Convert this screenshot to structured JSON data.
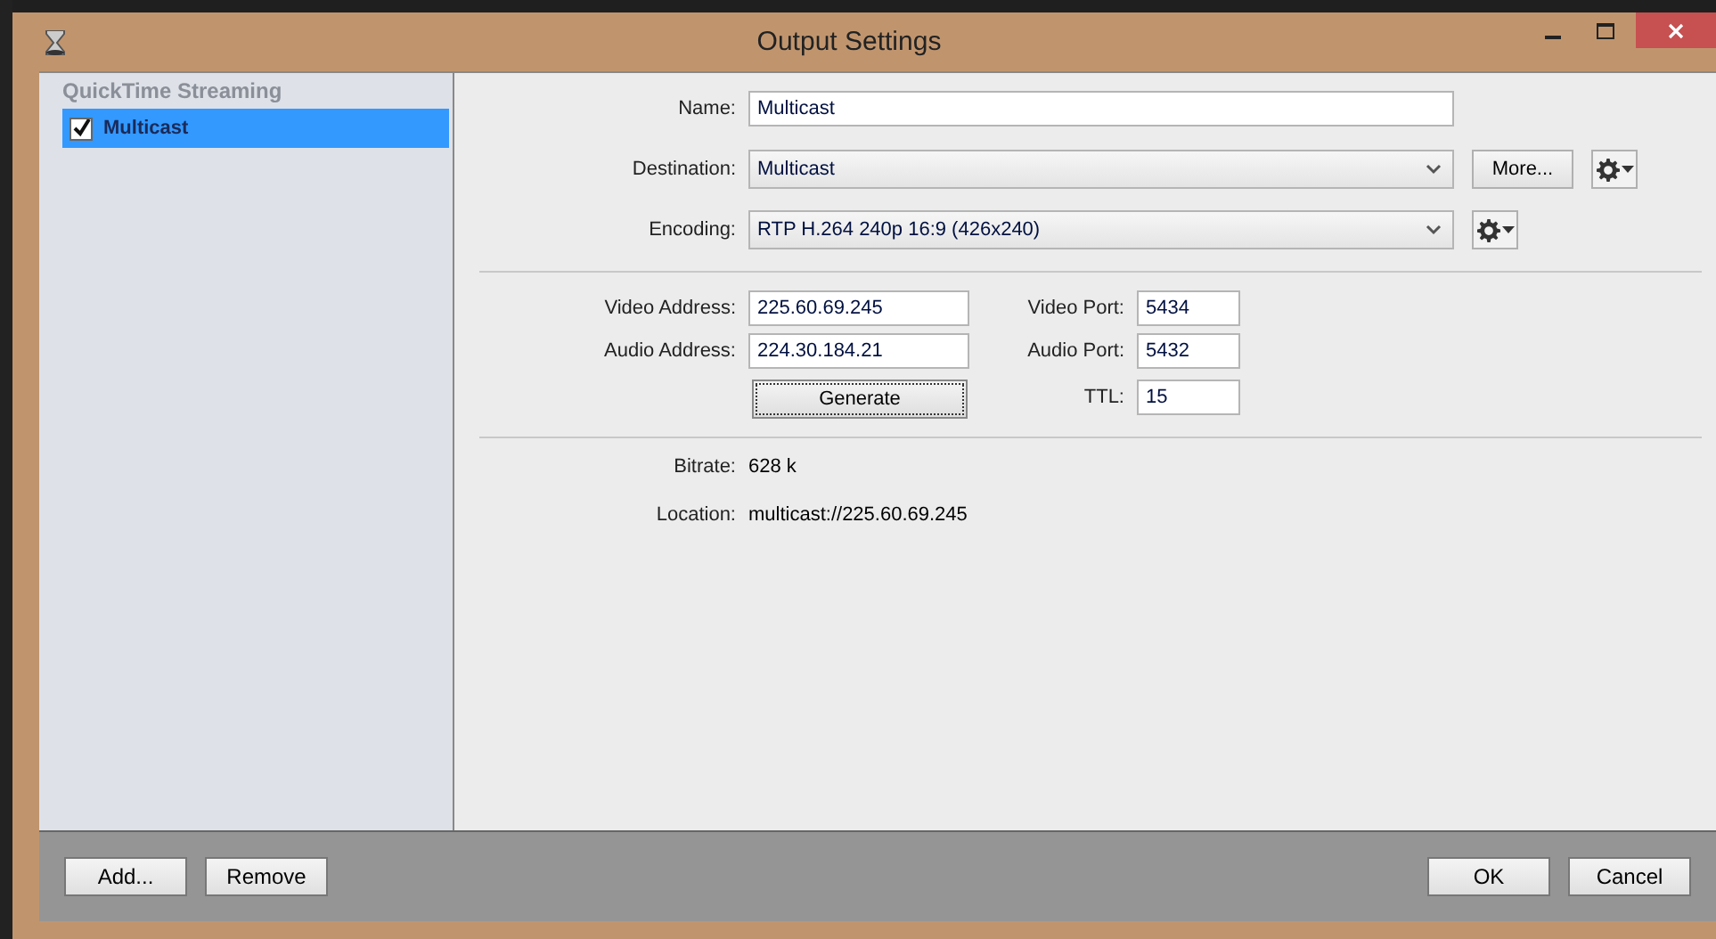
{
  "window": {
    "title": "Output Settings"
  },
  "sidebar": {
    "group": "QuickTime Streaming",
    "items": [
      {
        "label": "Multicast",
        "checked": true,
        "selected": true
      }
    ]
  },
  "form": {
    "name": {
      "label": "Name:",
      "value": "Multicast"
    },
    "destination": {
      "label": "Destination:",
      "value": "Multicast",
      "more_button": "More..."
    },
    "encoding": {
      "label": "Encoding:",
      "value": "RTP H.264 240p 16:9 (426x240)"
    },
    "video_address": {
      "label": "Video Address:",
      "value": "225.60.69.245"
    },
    "video_port": {
      "label": "Video Port:",
      "value": "5434"
    },
    "audio_address": {
      "label": "Audio Address:",
      "value": "224.30.184.21"
    },
    "audio_port": {
      "label": "Audio Port:",
      "value": "5432"
    },
    "generate_button": "Generate",
    "ttl": {
      "label": "TTL:",
      "value": "15"
    },
    "bitrate": {
      "label": "Bitrate:",
      "value": "628 k"
    },
    "location": {
      "label": "Location:",
      "value": "multicast://225.60.69.245"
    }
  },
  "footer": {
    "left_buttons": [
      "Add...",
      "Remove"
    ],
    "right_buttons": [
      "OK",
      "Cancel"
    ]
  }
}
